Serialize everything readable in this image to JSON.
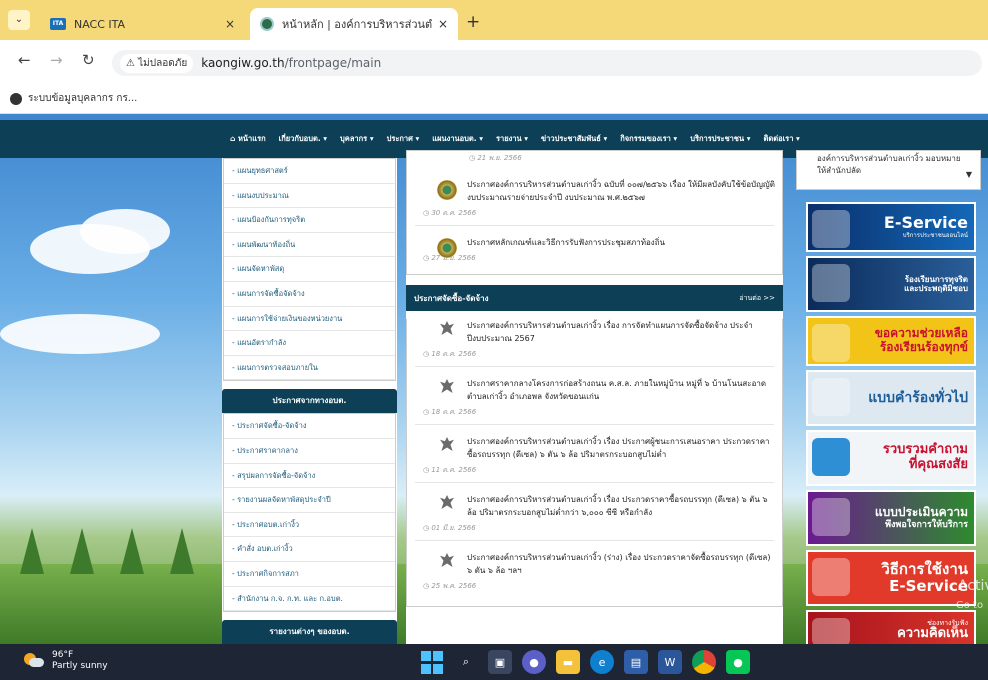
{
  "browser": {
    "tabs": [
      {
        "favicon": "ITA",
        "title": "NACC ITA"
      },
      {
        "favicon": "seal-icon",
        "title": "หน้าหลัก | องค์การบริหารส่วนตำบลเก"
      }
    ],
    "tab_close": "×",
    "new_tab": "+",
    "security_chip": "⚠ ไม่ปลอดภัย",
    "url_domain": "kaongiw.go.th",
    "url_path": "/frontpage/main",
    "bookmark": "ระบบข้อมูลบุคลากร กร..."
  },
  "site_menu": [
    "⌂ หน้าแรก",
    "เกี่ยวกับอบต. ▾",
    "บุคลากร ▾",
    "ประกาศ ▾",
    "แผนงานอบต. ▾",
    "รายงาน ▾",
    "ข่าวประชาสัมพันธ์ ▾",
    "กิจกรรมของเรา ▾",
    "บริการประชาชน ▾",
    "ติดต่อเรา ▾"
  ],
  "sidebar": {
    "plan_links": [
      "- แผนยุทธศาสตร์",
      "- แผนงบประมาณ",
      "- แผนป้องกันการทุจริต",
      "- แผนพัฒนาท้องถิ่น",
      "- แผนจัดหาพัสดุ",
      "- แผนการจัดซื้อจัดจ้าง",
      "- แผนการใช้จ่ายเงินของหน่วยงาน",
      "- แผนอัตรากำลัง",
      "- แผนการตรวจสอบภายใน"
    ],
    "announce_header": "ประกาศจากทางอบต.",
    "announce_links": [
      "- ประกาศจัดซื้อ-จัดจ้าง",
      "- ประกาศราคากลาง",
      "- สรุปผลการจัดซื้อ-จัดจ้าง",
      "- รายงานผลจัดหาพัสดุประจำปี",
      "- ประกาศอบต.เก่างิ้ว",
      "- คำสั่ง อบต.เก่างิ้ว",
      "- ประกาศกิจการสภา",
      "- สำนักงาน ก.จ. ก.ท. และ ก.อบต."
    ],
    "reports_header": "รายงานต่างๆ ของอบต."
  },
  "notices": {
    "top_date": "21 พ.ย. 2566",
    "items": [
      {
        "text": "ประกาศองค์การบริหารส่วนตำบลเก่างิ้ว ฉบับที่ ๐๐๗/๒๕๖๖ เรื่อง ให้มีผลบังคับใช้ข้อบัญญัติงบประมาณรายจ่ายประจำปี งบประมาณ พ.ศ.๒๕๖๗",
        "date": "30 ต.ค. 2566"
      },
      {
        "text": "ประกาศหลักเกณฑ์และวิธีการรับฟังการประชุมสภาท้องถิ่น",
        "date": "27 มี.ย. 2566"
      }
    ]
  },
  "procurement": {
    "title": "ประกาศจัดซื้อ-จัดจ้าง",
    "more": "อ่านต่อ >>",
    "items": [
      {
        "text": "ประกาศองค์การบริหารส่วนตำบลเก่างิ้ว เรื่อง การจัดทำแผนการจัดซื้อจัดจ้าง ประจำปีงบประมาณ 2567",
        "date": "18 ต.ค. 2566"
      },
      {
        "text": "ประกาศราคากลางโครงการก่อสร้างถนน ค.ส.ล. ภายในหมู่บ้าน หมู่ที่ ๖ บ้านโนนสะอาด ตำบลเก่างิ้ว อำเภอพล จังหวัดขอนแก่น",
        "date": "18 ต.ค. 2566"
      },
      {
        "text": "ประกาศองค์การบริหารส่วนตำบลเก่างิ้ว เรื่อง ประกาศผู้ชนะการเสนอราคา ประกวดราคาซื้อรถบรรทุก (ดีเซล) ๖ ตัน ๖ ล้อ ปริมาตรกระบอกสูบไม่ต่ำ",
        "date": "11 ต.ค. 2566"
      },
      {
        "text": "ประกาศองค์การบริหารส่วนตำบลเก่างิ้ว เรื่อง ประกวดราคาซื้อรถบรรทุก (ดีเซล) ๖ ตัน ๖ ล้อ ปริมาตรกระบอกสูบไม่ต่ำกว่า ๖,๐๐๐ ซีซี หรือกำลัง",
        "date": "01 มี.ย. 2566"
      },
      {
        "text": "ประกาศองค์การบริหารส่วนตำบลเก่างิ้ว (ร่าง) เรื่อง ประกวดราคาจัดซื้อรถบรรทุก (ดีเซล) ๖ ตัน ๖ ล้อ ฯลฯ",
        "date": "25 พ.ค. 2566"
      }
    ]
  },
  "right": {
    "notice_text": "องค์การบริหารส่วนตำบลเก่างิ้ว มอบหมายให้สำนักปลัด",
    "scroll_arrow": "▼",
    "banners": {
      "eservice": {
        "title": "E-Service",
        "sub": "บริการประชาชนออนไลน์"
      },
      "complaint": {
        "line1": "ร้องเรียนการทุจริต",
        "line2": "และประพฤติมิชอบ"
      },
      "help": {
        "line1": "ขอความช่วยเหลือ",
        "line2": "ร้องเรียนร้องทุกข์"
      },
      "forms": {
        "title": "แบบคำร้องทั่วไป"
      },
      "qa": {
        "line1": "รวบรวมคำถาม",
        "line2": "ที่คุณสงสัย"
      },
      "survey": {
        "line1": "แบบประเมินความ",
        "line2": "พึงพอใจการให้บริการ"
      },
      "howto": {
        "line1": "วิธีการใช้งาน",
        "line2": "E-Service"
      },
      "opinion": {
        "line1": "ช่องทางรับฟัง",
        "line2": "ความคิดเห็น"
      }
    }
  },
  "watermark": {
    "line1": "Activ",
    "line2": "Go to"
  },
  "taskbar": {
    "temp": "96°F",
    "condition": "Partly sunny"
  },
  "colors": {
    "menu_bar": "#0d3f57",
    "tab_strip": "#f5d978",
    "taskbar": "#1e2535"
  }
}
